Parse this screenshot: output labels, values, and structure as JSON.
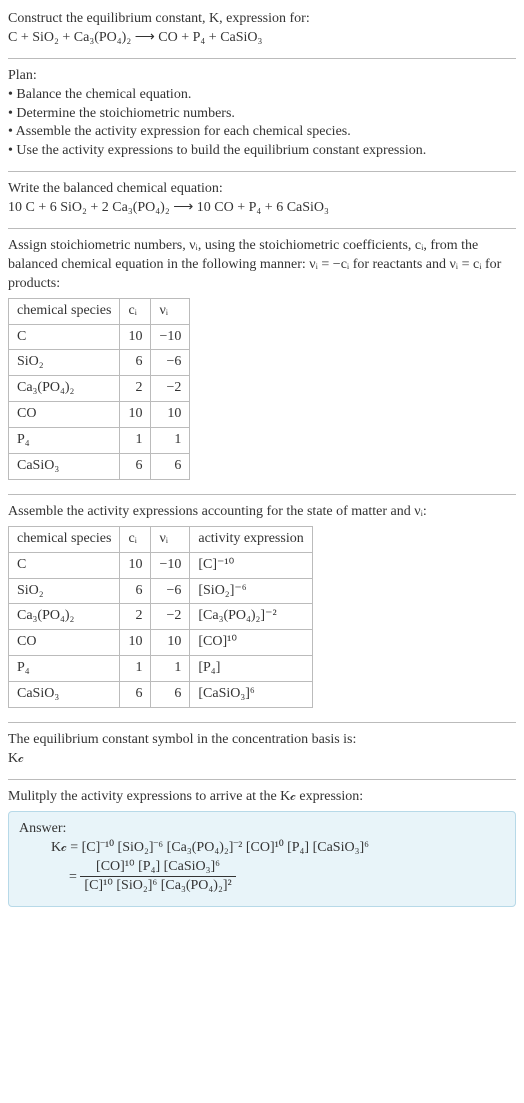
{
  "problem": {
    "title_line1": "Construct the equilibrium constant, K, expression for:",
    "equation_unbalanced": "C + SiO₂ + Ca₃(PO₄)₂  ⟶  CO + P₄ + CaSiO₃"
  },
  "plan": {
    "heading": "Plan:",
    "items": [
      "• Balance the chemical equation.",
      "• Determine the stoichiometric numbers.",
      "• Assemble the activity expression for each chemical species.",
      "• Use the activity expressions to build the equilibrium constant expression."
    ]
  },
  "balanced": {
    "heading": "Write the balanced chemical equation:",
    "equation": "10 C + 6 SiO₂ + 2 Ca₃(PO₄)₂  ⟶  10 CO + P₄ + 6 CaSiO₃"
  },
  "stoich": {
    "intro": "Assign stoichiometric numbers, νᵢ, using the stoichiometric coefficients, cᵢ, from the balanced chemical equation in the following manner: νᵢ = −cᵢ for reactants and νᵢ = cᵢ for products:",
    "headers": {
      "species": "chemical species",
      "ci": "cᵢ",
      "vi": "νᵢ"
    },
    "rows": [
      {
        "species": "C",
        "ci": "10",
        "vi": "−10"
      },
      {
        "species": "SiO₂",
        "ci": "6",
        "vi": "−6"
      },
      {
        "species": "Ca₃(PO₄)₂",
        "ci": "2",
        "vi": "−2"
      },
      {
        "species": "CO",
        "ci": "10",
        "vi": "10"
      },
      {
        "species": "P₄",
        "ci": "1",
        "vi": "1"
      },
      {
        "species": "CaSiO₃",
        "ci": "6",
        "vi": "6"
      }
    ]
  },
  "activity": {
    "intro": "Assemble the activity expressions accounting for the state of matter and νᵢ:",
    "headers": {
      "species": "chemical species",
      "ci": "cᵢ",
      "vi": "νᵢ",
      "expr": "activity expression"
    },
    "rows": [
      {
        "species": "C",
        "ci": "10",
        "vi": "−10",
        "expr": "[C]⁻¹⁰"
      },
      {
        "species": "SiO₂",
        "ci": "6",
        "vi": "−6",
        "expr": "[SiO₂]⁻⁶"
      },
      {
        "species": "Ca₃(PO₄)₂",
        "ci": "2",
        "vi": "−2",
        "expr": "[Ca₃(PO₄)₂]⁻²"
      },
      {
        "species": "CO",
        "ci": "10",
        "vi": "10",
        "expr": "[CO]¹⁰"
      },
      {
        "species": "P₄",
        "ci": "1",
        "vi": "1",
        "expr": "[P₄]"
      },
      {
        "species": "CaSiO₃",
        "ci": "6",
        "vi": "6",
        "expr": "[CaSiO₃]⁶"
      }
    ]
  },
  "symbol": {
    "line1": "The equilibrium constant symbol in the concentration basis is:",
    "line2": "K𝒸"
  },
  "multiply": {
    "heading": "Mulitply the activity expressions to arrive at the K𝒸 expression:"
  },
  "answer": {
    "label": "Answer:",
    "line1": "K𝒸 = [C]⁻¹⁰ [SiO₂]⁻⁶ [Ca₃(PO₄)₂]⁻² [CO]¹⁰ [P₄] [CaSiO₃]⁶",
    "eq": "=",
    "frac_num": "[CO]¹⁰ [P₄] [CaSiO₃]⁶",
    "frac_den": "[C]¹⁰ [SiO₂]⁶ [Ca₃(PO₄)₂]²"
  },
  "chart_data": {
    "type": "table",
    "tables": [
      {
        "title": "Stoichiometric numbers",
        "columns": [
          "chemical species",
          "cᵢ",
          "νᵢ"
        ],
        "rows": [
          [
            "C",
            10,
            -10
          ],
          [
            "SiO₂",
            6,
            -6
          ],
          [
            "Ca₃(PO₄)₂",
            2,
            -2
          ],
          [
            "CO",
            10,
            10
          ],
          [
            "P₄",
            1,
            1
          ],
          [
            "CaSiO₃",
            6,
            6
          ]
        ]
      },
      {
        "title": "Activity expressions",
        "columns": [
          "chemical species",
          "cᵢ",
          "νᵢ",
          "activity expression"
        ],
        "rows": [
          [
            "C",
            10,
            -10,
            "[C]^-10"
          ],
          [
            "SiO₂",
            6,
            -6,
            "[SiO₂]^-6"
          ],
          [
            "Ca₃(PO₄)₂",
            2,
            -2,
            "[Ca₃(PO₄)₂]^-2"
          ],
          [
            "CO",
            10,
            10,
            "[CO]^10"
          ],
          [
            "P₄",
            1,
            1,
            "[P₄]"
          ],
          [
            "CaSiO₃",
            6,
            6,
            "[CaSiO₃]^6"
          ]
        ]
      }
    ]
  }
}
